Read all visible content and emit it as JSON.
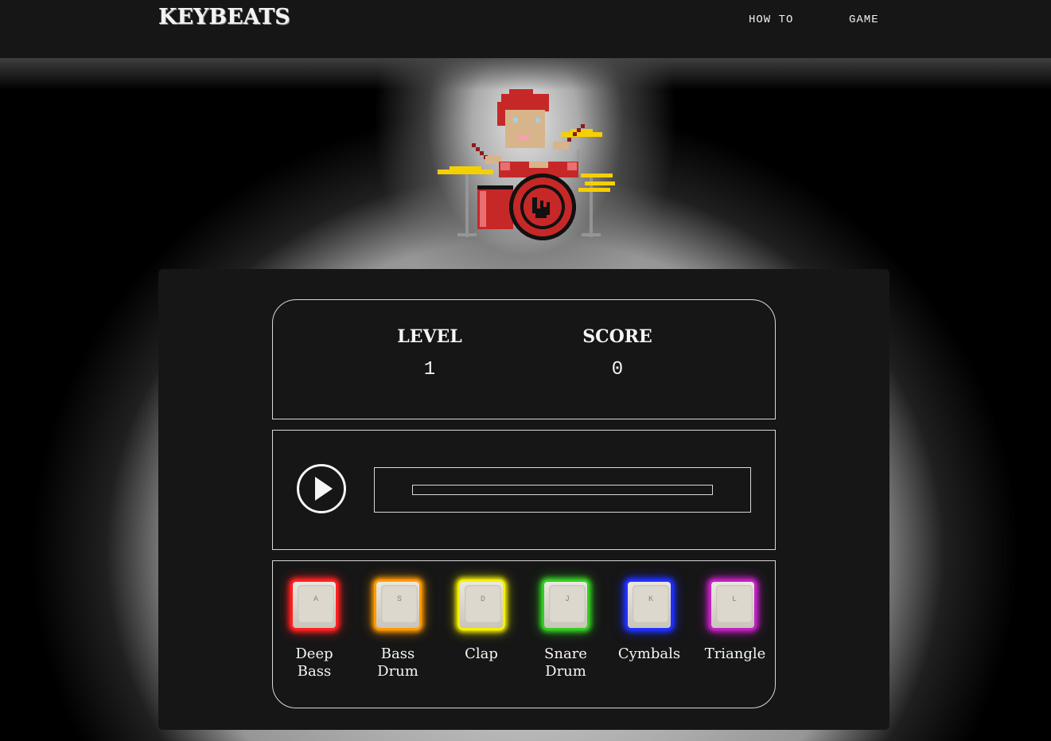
{
  "header": {
    "logo": "KEYBEATS",
    "nav": [
      {
        "label": "HOW TO"
      },
      {
        "label": "GAME"
      }
    ]
  },
  "stats": {
    "level_label": "LEVEL",
    "level_value": "1",
    "score_label": "SCORE",
    "score_value": "0"
  },
  "player": {
    "play_icon": "play-icon",
    "progress": 0
  },
  "keys": [
    {
      "letter": "A",
      "caption_line1": "Deep",
      "caption_line2": "Bass",
      "glow": "#ff2020"
    },
    {
      "letter": "S",
      "caption_line1": "Bass",
      "caption_line2": "Drum",
      "glow": "#ff9a00"
    },
    {
      "letter": "D",
      "caption_line1": "Clap",
      "caption_line2": "",
      "glow": "#f5f000"
    },
    {
      "letter": "J",
      "caption_line1": "Snare",
      "caption_line2": "Drum",
      "glow": "#33cc22"
    },
    {
      "letter": "K",
      "caption_line1": "Cymbals",
      "caption_line2": "",
      "glow": "#2030ff"
    },
    {
      "letter": "L",
      "caption_line1": "Triangle",
      "caption_line2": "",
      "glow": "#c020c0"
    }
  ],
  "colors": {
    "background": "#000000",
    "panel": "#161616",
    "outline": "#d8d8d8",
    "drum_red": "#c62828",
    "cymbal_yellow": "#f5d000"
  }
}
